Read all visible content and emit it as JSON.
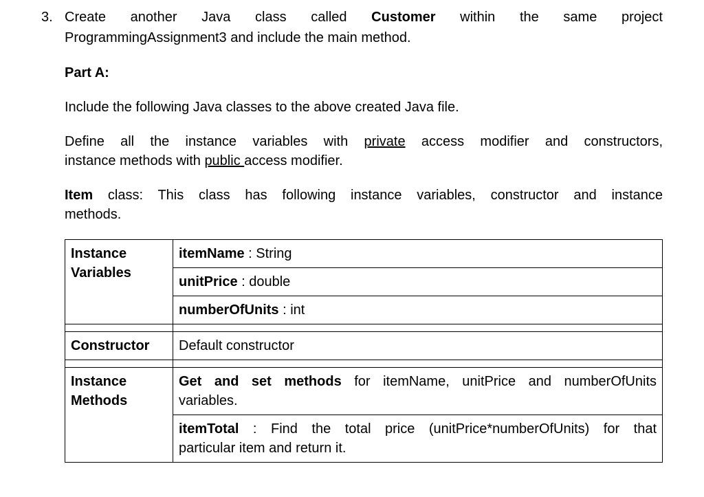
{
  "question": {
    "number": "3.",
    "line1_parts": [
      "Create",
      "another",
      "Java",
      "class",
      "called",
      "Customer",
      "within",
      "the",
      "same",
      "project"
    ],
    "line2": "ProgrammingAssignment3 and include the main method."
  },
  "partA": {
    "heading": "Part A:",
    "intro": "Include the following Java classes to the above created Java file.",
    "define_text_prefix": "Define all the instance variables with ",
    "private_word": "private",
    "define_text_mid": " access modifier and constructors, instance methods with ",
    "public_word": "public ",
    "define_text_suffix": "access modifier.",
    "item_class_prefix": "Item",
    "item_class_text": " class: This class has following instance variables, constructor and instance methods."
  },
  "table": {
    "instance_vars_label": "Instance Variables",
    "itemName_bold": "itemName",
    "itemName_rest": " : String",
    "unitPrice_bold": "unitPrice",
    "unitPrice_rest": " : double",
    "numberOfUnits_bold": "numberOfUnits",
    "numberOfUnits_rest": " : int",
    "constructor_label": "Constructor",
    "constructor_text": "Default constructor",
    "instance_methods_label": "Instance Methods",
    "getset_bold": "Get and set methods",
    "getset_rest_line1": " for itemName, unitPrice and numberOfUnits",
    "getset_line2": "variables.",
    "itemTotal_bold": "itemTotal",
    "itemTotal_rest_line1": " : Find the total price (unitPrice*numberOfUnits) for that",
    "itemTotal_line2": "particular item and return it."
  }
}
